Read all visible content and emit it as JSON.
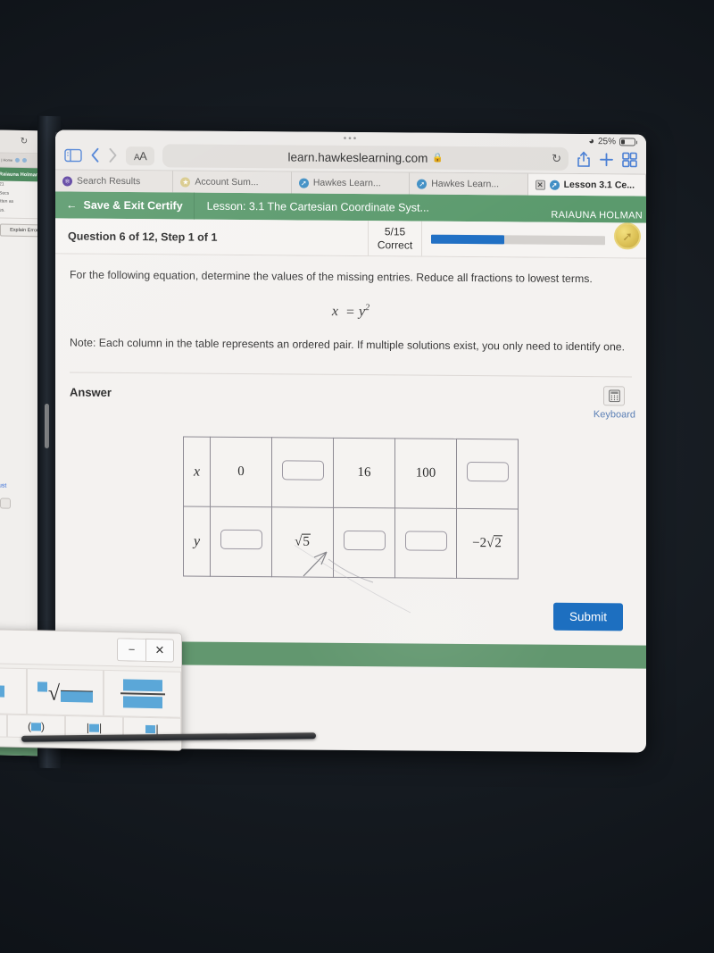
{
  "device": {
    "status": {
      "battery_percent": "25%",
      "wifi_icon": "wifi-icon"
    }
  },
  "browser": {
    "url": "learn.hawkeslearning.com",
    "lock_icon": "lock-icon",
    "text_size_button": "AA",
    "text_size_small": "A",
    "text_size_large": "A",
    "sidebar_icon": "sidebar-toggle-icon",
    "back_icon": "chevron-left-icon",
    "forward_icon": "chevron-right-icon",
    "reload_icon": "reload-icon",
    "share_icon": "share-icon",
    "newtab_icon": "plus-icon",
    "tabs_overview_icon": "tab-grid-icon",
    "tabs": [
      {
        "label": "Search Results",
        "favicon": "search-favicon",
        "active": false
      },
      {
        "label": "Account Sum...",
        "favicon": "account-favicon",
        "active": false
      },
      {
        "label": "Hawkes Learn...",
        "favicon": "hawkes-favicon",
        "active": false
      },
      {
        "label": "Hawkes Learn...",
        "favicon": "hawkes-favicon",
        "active": false
      },
      {
        "label": "Lesson 3.1 Ce...",
        "favicon": "hawkes-favicon",
        "active": true
      }
    ]
  },
  "app_header": {
    "save_exit_label": "Save & Exit Certify",
    "back_arrow_icon": "arrow-left-icon",
    "lesson_title": "Lesson: 3.1 The Cartesian Coordinate Syst...",
    "user_name": "RAIAUNA HOLMAN"
  },
  "question_bar": {
    "title": "Question 6 of 12, Step 1 of 1",
    "score": "5/15",
    "score_label": "Correct",
    "progress_percent": 42,
    "coin_icon": "coin-badge-icon"
  },
  "question": {
    "prompt": "For the following equation, determine the values of the missing entries. Reduce all fractions to lowest terms.",
    "equation_lhs": "x",
    "equation_eq": "=",
    "equation_rhs_base": "y",
    "equation_rhs_exp": "2",
    "note": "Note: Each column in the table represents an ordered pair. If multiple solutions exist, you only need to identify one."
  },
  "answer": {
    "label": "Answer",
    "keyboard_label": "Keyboard",
    "keyboard_icon": "calculator-keypad-icon",
    "table": {
      "rows": [
        {
          "header": "x",
          "cells": [
            {
              "type": "value",
              "text": "0"
            },
            {
              "type": "blank",
              "text": ""
            },
            {
              "type": "value",
              "text": "16"
            },
            {
              "type": "value",
              "text": "100"
            },
            {
              "type": "blank",
              "text": ""
            }
          ]
        },
        {
          "header": "y",
          "cells": [
            {
              "type": "blank",
              "text": ""
            },
            {
              "type": "radical",
              "coefficient": "",
              "radicand": "5"
            },
            {
              "type": "blank",
              "text": ""
            },
            {
              "type": "blank",
              "text": ""
            },
            {
              "type": "radical",
              "coefficient": "−2",
              "radicand": "2"
            }
          ]
        }
      ]
    }
  },
  "footer": {
    "submit_label": "Submit"
  },
  "math_keyboard": {
    "minimize_icon": "minimize-icon",
    "close_icon": "close-icon",
    "keys": [
      {
        "name": "superscript-template-key"
      },
      {
        "name": "square-root-template-key",
        "symbol": "√"
      },
      {
        "name": "fraction-template-key"
      }
    ],
    "keys_row2": [
      {
        "name": "bracket-template-key"
      },
      {
        "name": "paren-template-key"
      },
      {
        "name": "abs-template-key"
      },
      {
        "name": "misc-template-key"
      }
    ]
  },
  "background_window": {
    "reload_icon": "reload-icon",
    "user_name": "Raiauna Holman",
    "time_value": "21",
    "time_unit": "Secs",
    "line1": "itten as",
    "line2": "es.",
    "explain_error_label": "Explain Error",
    "link_fragment": "ust",
    "icon_name": "image-icon"
  },
  "colors": {
    "app_green": "#5b9a6d",
    "accent_blue": "#1d6fc0",
    "coin_gold": "#ddc257",
    "link_blue": "#5a7fb5",
    "math_key_blue": "#5ba7d8"
  }
}
